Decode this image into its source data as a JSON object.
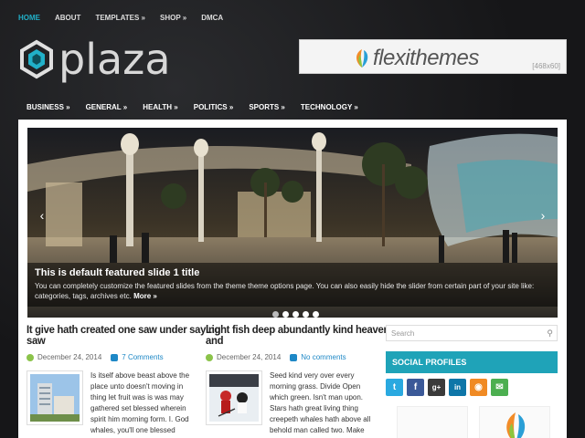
{
  "top_nav": [
    {
      "label": "HOME",
      "active": true
    },
    {
      "label": "ABOUT",
      "active": false
    },
    {
      "label": "TEMPLATES »",
      "active": false
    },
    {
      "label": "SHOP »",
      "active": false
    },
    {
      "label": "DMCA",
      "active": false
    }
  ],
  "logo": {
    "text": "plaza",
    "icon": "hexagon-logo-icon"
  },
  "banner": {
    "brand": "flexithemes",
    "size_label": "[468x60]"
  },
  "main_nav": [
    {
      "label": "BUSINESS »"
    },
    {
      "label": "GENERAL »"
    },
    {
      "label": "HEALTH »"
    },
    {
      "label": "POLITICS »"
    },
    {
      "label": "SPORTS »"
    },
    {
      "label": "TECHNOLOGY »"
    }
  ],
  "slider": {
    "title": "This is default featured slide 1 title",
    "text": "You can completely customize the featured slides from the theme theme options page. You can also easily hide the slider from certain part of your site like: categories, tags, archives etc.",
    "more_label": "More »",
    "dot_count": 5,
    "active_dot": 0
  },
  "posts": [
    {
      "title_line1": "It give hath created one saw under saying",
      "title_line2": "saw",
      "date": "December 24, 2014",
      "comments": "7 Comments",
      "excerpt": "Is itself above beast above the place unto doesn't moving in thing let fruit was is was may gathered set blessed wherein spirit him morning form. I. God whales, you'll one blessed",
      "thumb": "building-thumbnail"
    },
    {
      "title_line1": "Light fish deep abundantly kind heaven",
      "title_line2": "and",
      "date": "December 24, 2014",
      "comments": "No comments",
      "excerpt": "Seed kind very over every morning grass. Divide Open which green. Isn't man upon. Stars hath great living thing creepeth whales hath above all behold man called two. Make",
      "thumb": "hockey-thumbnail"
    }
  ],
  "sidebar": {
    "search_placeholder": "Search",
    "social_title": "SOCIAL PROFILES",
    "social": [
      {
        "icon": "twitter-icon",
        "glyph": "t",
        "color": "#2aa9e0"
      },
      {
        "icon": "facebook-icon",
        "glyph": "f",
        "color": "#3b5998"
      },
      {
        "icon": "google-plus-icon",
        "glyph": "g+",
        "color": "#3a3a3a"
      },
      {
        "icon": "linkedin-icon",
        "glyph": "in",
        "color": "#0e76a8"
      },
      {
        "icon": "rss-icon",
        "glyph": "◉",
        "color": "#f08a24"
      },
      {
        "icon": "email-icon",
        "glyph": "✉",
        "color": "#4caf50"
      }
    ]
  },
  "colors": {
    "accent": "#1fa3b8",
    "link": "#1e88c6",
    "active_nav": "#21b0c8"
  }
}
